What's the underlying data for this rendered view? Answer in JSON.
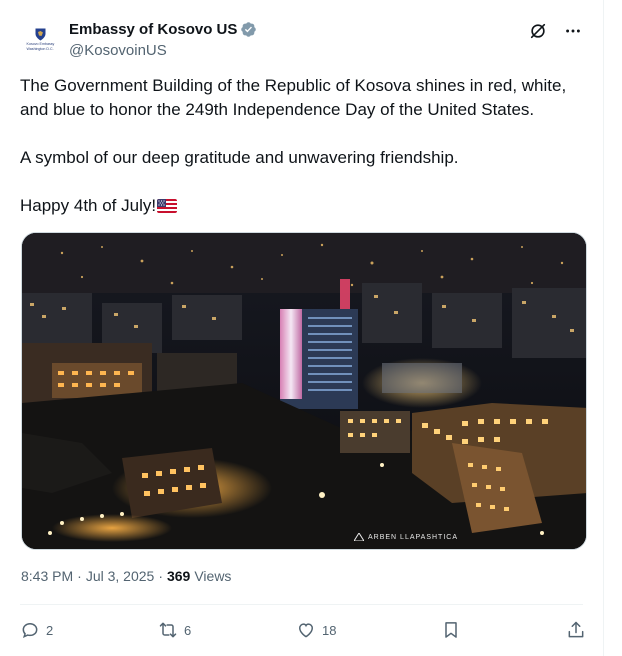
{
  "author": {
    "display_name": "Embassy of Kosovo US",
    "handle": "@KosovoinUS",
    "avatar_lines": [
      "Kosovo Embassy",
      "Washington D.C."
    ]
  },
  "tweet": {
    "paragraphs": [
      "The Government Building of the Republic of Kosova shines in red, white, and blue to honor the 249th Independence Day of the United States.",
      "A symbol of our deep gratitude and unwavering friendship.",
      "Happy 4th of July!"
    ]
  },
  "media": {
    "watermark": "ARBEN LLAPASHTICA"
  },
  "meta": {
    "time": "8:43 PM",
    "date": "Jul 3, 2025",
    "views_count": "369",
    "views_label": "Views",
    "separator": "·"
  },
  "actions": {
    "replies": "2",
    "reposts": "6",
    "likes": "18"
  },
  "colors": {
    "text": "#0f1419",
    "secondary": "#536471",
    "verified": "#829aab",
    "divider": "#eff3f4"
  }
}
